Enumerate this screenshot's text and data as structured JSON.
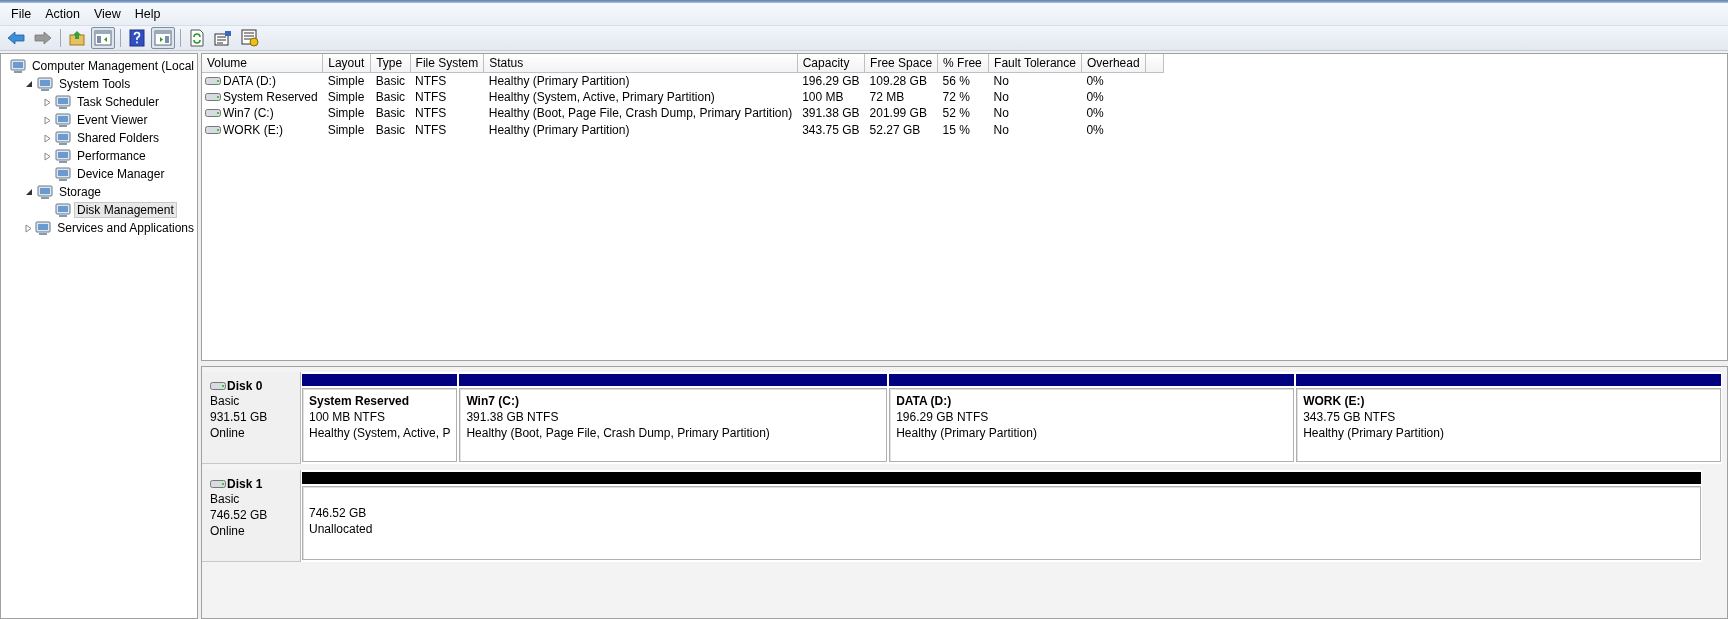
{
  "menu": [
    "File",
    "Action",
    "View",
    "Help"
  ],
  "toolbar": [
    {
      "kind": "back",
      "disabled": false,
      "pressed": false
    },
    {
      "kind": "forward",
      "disabled": true,
      "pressed": false
    },
    {
      "kind": "sep"
    },
    {
      "kind": "up",
      "pressed": false
    },
    {
      "kind": "tree",
      "pressed": true
    },
    {
      "kind": "sep"
    },
    {
      "kind": "help",
      "pressed": false
    },
    {
      "kind": "pane",
      "pressed": true
    },
    {
      "kind": "sep"
    },
    {
      "kind": "refresh",
      "pressed": false
    },
    {
      "kind": "properties",
      "pressed": false
    },
    {
      "kind": "settings",
      "pressed": false
    }
  ],
  "tree": [
    {
      "label": "Computer Management (Local",
      "selected": false,
      "children": [
        {
          "label": "System Tools",
          "expanded": true,
          "selected": false,
          "children": [
            {
              "label": "Task Scheduler",
              "expanded": false,
              "selected": false
            },
            {
              "label": "Event Viewer",
              "expanded": false,
              "selected": false
            },
            {
              "label": "Shared Folders",
              "expanded": false,
              "selected": false
            },
            {
              "label": "Performance",
              "expanded": false,
              "selected": false
            },
            {
              "label": "Device Manager",
              "selected": false
            }
          ]
        },
        {
          "label": "Storage",
          "expanded": true,
          "selected": false,
          "children": [
            {
              "label": "Disk Management",
              "selected": true
            }
          ]
        },
        {
          "label": "Services and Applications",
          "expanded": false,
          "selected": false
        }
      ]
    }
  ],
  "volumes": {
    "columns": [
      "Volume",
      "Layout",
      "Type",
      "File System",
      "Status",
      "Capacity",
      "Free Space",
      "% Free",
      "Fault Tolerance",
      "Overhead"
    ],
    "rows": [
      {
        "cells": [
          "DATA (D:)",
          "Simple",
          "Basic",
          "NTFS",
          "Healthy (Primary Partition)",
          "196.29 GB",
          "109.28 GB",
          "56 %",
          "No",
          "0%"
        ]
      },
      {
        "cells": [
          "System Reserved",
          "Simple",
          "Basic",
          "NTFS",
          "Healthy (System, Active, Primary Partition)",
          "100 MB",
          "72 MB",
          "72 %",
          "No",
          "0%"
        ]
      },
      {
        "cells": [
          "Win7 (C:)",
          "Simple",
          "Basic",
          "NTFS",
          "Healthy (Boot, Page File, Crash Dump, Primary Partition)",
          "391.38 GB",
          "201.99 GB",
          "52 %",
          "No",
          "0%"
        ]
      },
      {
        "cells": [
          "WORK (E:)",
          "Simple",
          "Basic",
          "NTFS",
          "Healthy (Primary Partition)",
          "343.75 GB",
          "52.27 GB",
          "15 %",
          "No",
          "0%"
        ]
      }
    ]
  },
  "disks": [
    {
      "name": "Disk 0",
      "type": "Basic",
      "size": "931.51 GB",
      "state": "Online",
      "partitions": [
        {
          "name": "System Reserved",
          "size": "100 MB NTFS",
          "status": "Healthy (System, Active, P",
          "color": "#000080"
        },
        {
          "name": "Win7  (C:)",
          "size": "391.38 GB NTFS",
          "status": "Healthy (Boot, Page File, Crash Dump, Primary Partition)",
          "color": "#000080"
        },
        {
          "name": "DATA  (D:)",
          "size": "196.29 GB NTFS",
          "status": "Healthy (Primary Partition)",
          "color": "#000080"
        },
        {
          "name": "WORK  (E:)",
          "size": "343.75 GB NTFS",
          "status": "Healthy (Primary Partition)",
          "color": "#000080"
        }
      ]
    },
    {
      "name": "Disk 1",
      "type": "Basic",
      "size": "746.52 GB",
      "state": "Online",
      "partitions": [
        {
          "size": "746.52 GB",
          "status": "Unallocated",
          "color": "#000000"
        }
      ]
    }
  ]
}
